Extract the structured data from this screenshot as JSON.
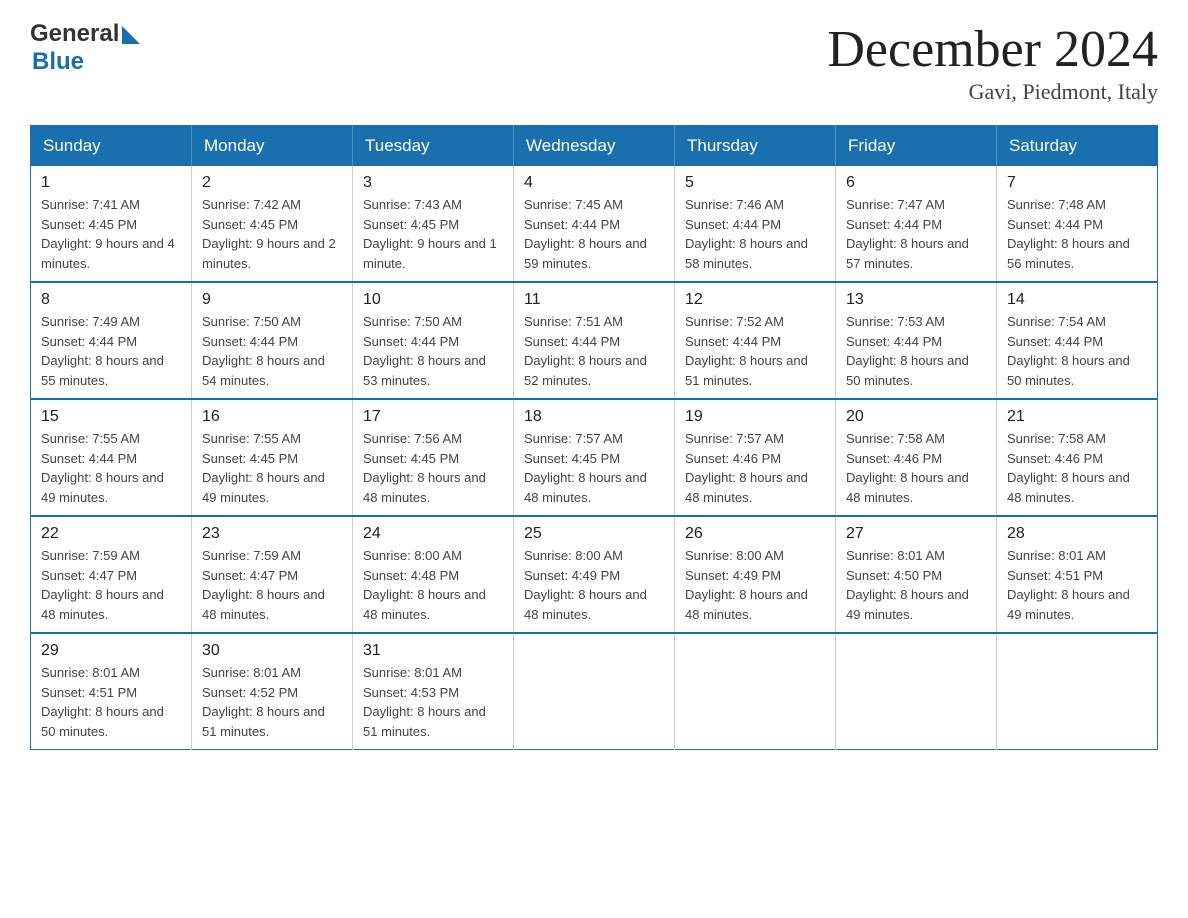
{
  "header": {
    "logo_line1": "General",
    "logo_line2": "Blue",
    "month_title": "December 2024",
    "location": "Gavi, Piedmont, Italy"
  },
  "weekdays": [
    "Sunday",
    "Monday",
    "Tuesday",
    "Wednesday",
    "Thursday",
    "Friday",
    "Saturday"
  ],
  "weeks": [
    [
      {
        "day": "1",
        "sunrise": "7:41 AM",
        "sunset": "4:45 PM",
        "daylight": "9 hours and 4 minutes."
      },
      {
        "day": "2",
        "sunrise": "7:42 AM",
        "sunset": "4:45 PM",
        "daylight": "9 hours and 2 minutes."
      },
      {
        "day": "3",
        "sunrise": "7:43 AM",
        "sunset": "4:45 PM",
        "daylight": "9 hours and 1 minute."
      },
      {
        "day": "4",
        "sunrise": "7:45 AM",
        "sunset": "4:44 PM",
        "daylight": "8 hours and 59 minutes."
      },
      {
        "day": "5",
        "sunrise": "7:46 AM",
        "sunset": "4:44 PM",
        "daylight": "8 hours and 58 minutes."
      },
      {
        "day": "6",
        "sunrise": "7:47 AM",
        "sunset": "4:44 PM",
        "daylight": "8 hours and 57 minutes."
      },
      {
        "day": "7",
        "sunrise": "7:48 AM",
        "sunset": "4:44 PM",
        "daylight": "8 hours and 56 minutes."
      }
    ],
    [
      {
        "day": "8",
        "sunrise": "7:49 AM",
        "sunset": "4:44 PM",
        "daylight": "8 hours and 55 minutes."
      },
      {
        "day": "9",
        "sunrise": "7:50 AM",
        "sunset": "4:44 PM",
        "daylight": "8 hours and 54 minutes."
      },
      {
        "day": "10",
        "sunrise": "7:50 AM",
        "sunset": "4:44 PM",
        "daylight": "8 hours and 53 minutes."
      },
      {
        "day": "11",
        "sunrise": "7:51 AM",
        "sunset": "4:44 PM",
        "daylight": "8 hours and 52 minutes."
      },
      {
        "day": "12",
        "sunrise": "7:52 AM",
        "sunset": "4:44 PM",
        "daylight": "8 hours and 51 minutes."
      },
      {
        "day": "13",
        "sunrise": "7:53 AM",
        "sunset": "4:44 PM",
        "daylight": "8 hours and 50 minutes."
      },
      {
        "day": "14",
        "sunrise": "7:54 AM",
        "sunset": "4:44 PM",
        "daylight": "8 hours and 50 minutes."
      }
    ],
    [
      {
        "day": "15",
        "sunrise": "7:55 AM",
        "sunset": "4:44 PM",
        "daylight": "8 hours and 49 minutes."
      },
      {
        "day": "16",
        "sunrise": "7:55 AM",
        "sunset": "4:45 PM",
        "daylight": "8 hours and 49 minutes."
      },
      {
        "day": "17",
        "sunrise": "7:56 AM",
        "sunset": "4:45 PM",
        "daylight": "8 hours and 48 minutes."
      },
      {
        "day": "18",
        "sunrise": "7:57 AM",
        "sunset": "4:45 PM",
        "daylight": "8 hours and 48 minutes."
      },
      {
        "day": "19",
        "sunrise": "7:57 AM",
        "sunset": "4:46 PM",
        "daylight": "8 hours and 48 minutes."
      },
      {
        "day": "20",
        "sunrise": "7:58 AM",
        "sunset": "4:46 PM",
        "daylight": "8 hours and 48 minutes."
      },
      {
        "day": "21",
        "sunrise": "7:58 AM",
        "sunset": "4:46 PM",
        "daylight": "8 hours and 48 minutes."
      }
    ],
    [
      {
        "day": "22",
        "sunrise": "7:59 AM",
        "sunset": "4:47 PM",
        "daylight": "8 hours and 48 minutes."
      },
      {
        "day": "23",
        "sunrise": "7:59 AM",
        "sunset": "4:47 PM",
        "daylight": "8 hours and 48 minutes."
      },
      {
        "day": "24",
        "sunrise": "8:00 AM",
        "sunset": "4:48 PM",
        "daylight": "8 hours and 48 minutes."
      },
      {
        "day": "25",
        "sunrise": "8:00 AM",
        "sunset": "4:49 PM",
        "daylight": "8 hours and 48 minutes."
      },
      {
        "day": "26",
        "sunrise": "8:00 AM",
        "sunset": "4:49 PM",
        "daylight": "8 hours and 48 minutes."
      },
      {
        "day": "27",
        "sunrise": "8:01 AM",
        "sunset": "4:50 PM",
        "daylight": "8 hours and 49 minutes."
      },
      {
        "day": "28",
        "sunrise": "8:01 AM",
        "sunset": "4:51 PM",
        "daylight": "8 hours and 49 minutes."
      }
    ],
    [
      {
        "day": "29",
        "sunrise": "8:01 AM",
        "sunset": "4:51 PM",
        "daylight": "8 hours and 50 minutes."
      },
      {
        "day": "30",
        "sunrise": "8:01 AM",
        "sunset": "4:52 PM",
        "daylight": "8 hours and 51 minutes."
      },
      {
        "day": "31",
        "sunrise": "8:01 AM",
        "sunset": "4:53 PM",
        "daylight": "8 hours and 51 minutes."
      },
      null,
      null,
      null,
      null
    ]
  ],
  "labels": {
    "sunrise_prefix": "Sunrise: ",
    "sunset_prefix": "Sunset: ",
    "daylight_prefix": "Daylight: "
  }
}
